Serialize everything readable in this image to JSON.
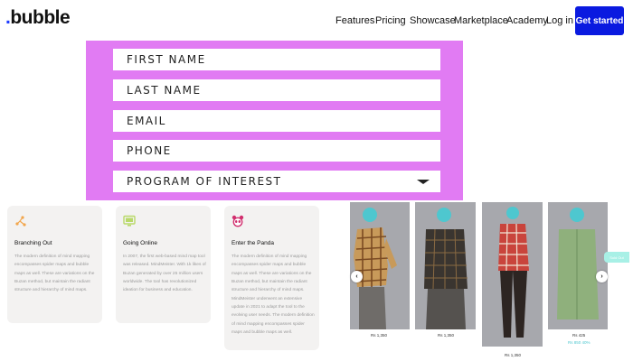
{
  "header": {
    "logo": "bubble",
    "nav": [
      "Features",
      "Pricing",
      "Showcase",
      "Marketplace",
      "Academy"
    ],
    "login": "Log in",
    "cta": "Get started"
  },
  "form": {
    "fields": [
      "FIRST NAME",
      "LAST NAME",
      "EMAIL",
      "PHONE"
    ],
    "select": "PROGRAM OF INTEREST"
  },
  "cards": [
    {
      "title": "Branching Out",
      "icon": "branching-icon",
      "body": "The modern definition of mind mapping encompasses spider maps and bubble maps as well. These are variations on the Buzan method, but maintain the radiant structure and hierarchy of mind maps."
    },
    {
      "title": "Going Online",
      "icon": "monitor-icon",
      "body": "In 2007, the first web-based mind map tool was released. MindMeister. With 1k likes of Buzan generated by over 25 million users worldwide. The tool has revolutionized ideation for business and education."
    },
    {
      "title": "Enter the Panda",
      "icon": "panda-icon",
      "body": "The modern definition of mind mapping encompasses spider maps and bubble maps as well. These are variations on the Buzan method, but maintain the radiant structure and hierarchy of mind maps. MindMeister underwent an extensive update in 2021 to adapt the tool to the evolving user needs. The modern definition of mind mapping encompasses spider maps and bubble maps as well."
    }
  ],
  "carousel": {
    "prices": [
      "Rs 1,350",
      "Rs 1,350",
      "Rs 1,350",
      "Rs 425"
    ],
    "price_note": "Rs 850 40%",
    "badge": "Sold Out",
    "prev_icon": "chevron-left-icon",
    "next_icon": "chevron-right-icon"
  },
  "colors": {
    "form_bg": "#e17bf3",
    "cta_bg": "#0a1ae0",
    "card_icon": "#f2a64c",
    "card_icon_2": "#b9d96a",
    "card_icon_3": "#d12f6e",
    "teal": "#a8f0e6"
  }
}
